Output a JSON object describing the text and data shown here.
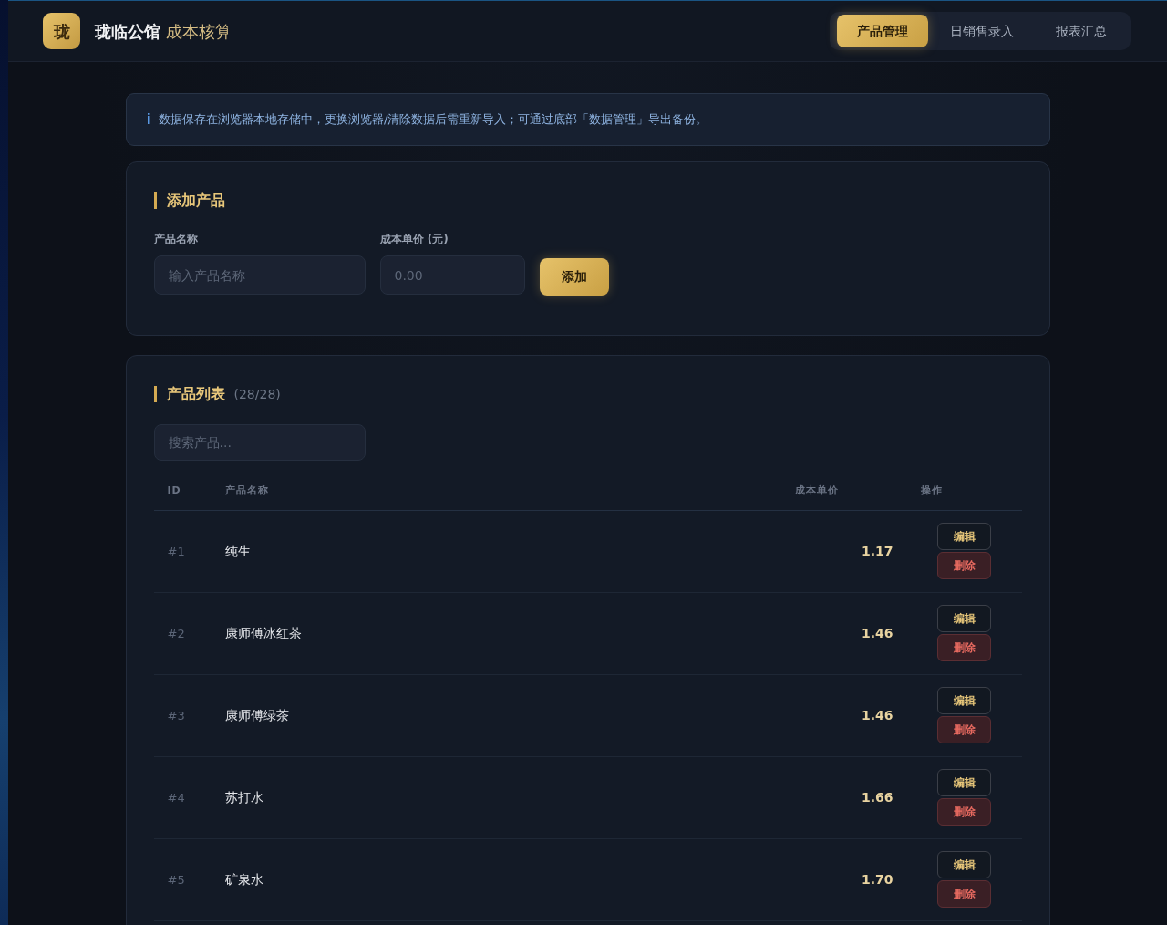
{
  "app": {
    "logo": "珑",
    "title": "珑临公馆",
    "subtitle": "成本核算"
  },
  "tabs": [
    {
      "label": "产品管理",
      "selected": true
    },
    {
      "label": "日销售录入",
      "selected": false
    },
    {
      "label": "报表汇总",
      "selected": false
    }
  ],
  "notice": {
    "icon": "i",
    "text": "数据保存在浏览器本地存储中，更换浏览器/清除数据后需重新导入；可通过底部「数据管理」导出备份。"
  },
  "add_product": {
    "title": "添加产品",
    "fields": [
      {
        "label": "产品名称",
        "placeholder": "输入产品名称"
      },
      {
        "label": "成本单价 (元)",
        "placeholder": "0.00"
      }
    ],
    "button": "添加"
  },
  "product_list": {
    "title": "产品列表",
    "count": "(28/28)",
    "search": {
      "placeholder": "搜索产品..."
    },
    "columns": [
      "ID",
      "产品名称",
      "成本单价",
      "操作"
    ],
    "rows": [
      {
        "id": "#1",
        "name": "纯生",
        "cost": "1.17",
        "actions": [
          {
            "kind": "edit",
            "label": "编辑"
          },
          {
            "kind": "delete",
            "label": "删除"
          }
        ]
      },
      {
        "id": "#2",
        "name": "康师傅冰红茶",
        "cost": "1.46",
        "actions": [
          {
            "kind": "edit",
            "label": "编辑"
          },
          {
            "kind": "delete",
            "label": "删除"
          }
        ]
      },
      {
        "id": "#3",
        "name": "康师傅绿茶",
        "cost": "1.46",
        "actions": [
          {
            "kind": "edit",
            "label": "编辑"
          },
          {
            "kind": "delete",
            "label": "删除"
          }
        ]
      },
      {
        "id": "#4",
        "name": "苏打水",
        "cost": "1.66",
        "actions": [
          {
            "kind": "edit",
            "label": "编辑"
          },
          {
            "kind": "delete",
            "label": "删除"
          }
        ]
      },
      {
        "id": "#5",
        "name": "矿泉水",
        "cost": "1.70",
        "actions": [
          {
            "kind": "edit",
            "label": "编辑"
          },
          {
            "kind": "delete",
            "label": "删除"
          }
        ]
      }
    ]
  }
}
